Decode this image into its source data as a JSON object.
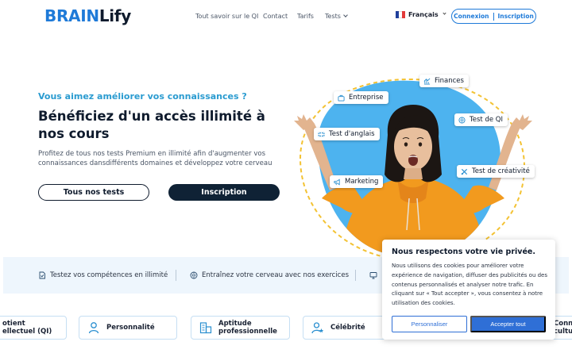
{
  "brand": {
    "logo_part1": "BRAIN",
    "logo_part2": "Lify"
  },
  "nav": {
    "items": [
      {
        "label": "Tout savoir sur le QI"
      },
      {
        "label": "Contact"
      },
      {
        "label": "Tarifs"
      },
      {
        "label": "Tests"
      }
    ]
  },
  "language": {
    "label": "Français",
    "flag_colors": [
      "#1f3f9b",
      "#ffffff",
      "#e23a3a"
    ]
  },
  "auth": {
    "login": "Connexion",
    "signup": "Inscription"
  },
  "hero": {
    "kicker": "Vous aimez améliorer vos connaissances ?",
    "title": "Bénéficiez d'un accès illimité à nos cours",
    "description": "Profitez de tous nos tests Premium en illimité afin d'augmenter vos connaissances dansdifférents domaines et développez votre cerveau",
    "primary_button": "Tous nos tests",
    "secondary_button": "Inscription"
  },
  "chips": [
    {
      "label": "Finances",
      "icon": "chart-icon"
    },
    {
      "label": "Entreprise",
      "icon": "briefcase-icon"
    },
    {
      "label": "Test de QI",
      "icon": "brain-icon"
    },
    {
      "label": "Test d'anglais",
      "icon": "flag-uk-icon"
    },
    {
      "label": "Test de créativité",
      "icon": "tools-icon"
    },
    {
      "label": "Marketing",
      "icon": "megaphone-icon"
    }
  ],
  "features": [
    {
      "label": "Testez vos compétences en illimité",
      "icon": "document-check-icon"
    },
    {
      "label": "Entraînez votre cerveau avec nos exercices",
      "icon": "brain-icon"
    }
  ],
  "categories": [
    {
      "line1": "otient",
      "line2": "ellectuel (QI)",
      "icon": "none"
    },
    {
      "line1": "Personnalité",
      "line2": "",
      "icon": "person-icon"
    },
    {
      "line1": "Aptitude",
      "line2": "professionnelle",
      "icon": "building-icon"
    },
    {
      "line1": "Célébrité",
      "line2": "",
      "icon": "person-star-icon"
    },
    {
      "line1": "Conn",
      "line2": "cultu",
      "icon": "none"
    }
  ],
  "cookie": {
    "title": "Nous respectons votre vie privée.",
    "text": "Nous utilisons des cookies pour améliorer votre expérience de navigation, diffuser des publicités ou des contenus personnalisés et analyser notre trafic. En cliquant sur « Tout accepter », vous consentez à notre utilisation des cookies.",
    "customize": "Personnaliser",
    "accept": "Accepter tout"
  },
  "colors": {
    "brand_blue": "#1e7ad8",
    "navy": "#0f2235",
    "kicker": "#2a9bd0",
    "blob": "#4db3ef",
    "hoodie": "#f29a1e",
    "dash": "#f3c233"
  }
}
